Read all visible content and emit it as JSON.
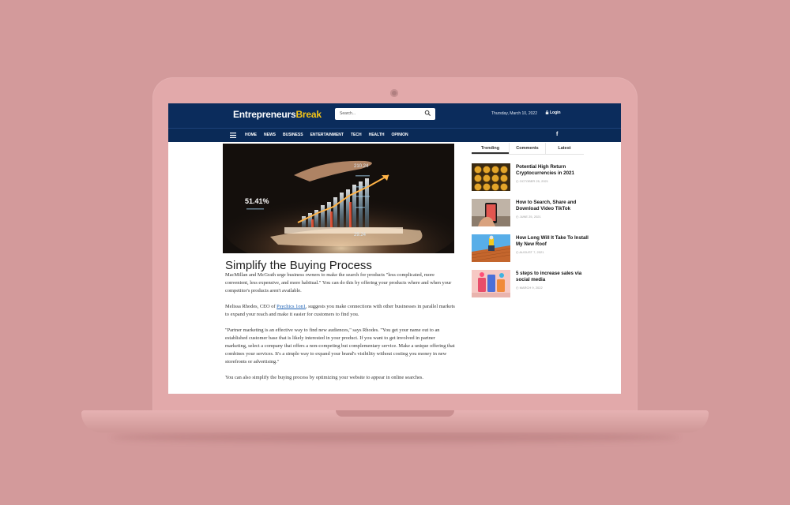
{
  "site": {
    "logo_main": "Entrepreneurs",
    "logo_accent": "Break",
    "search_placeholder": "Search...",
    "date": "Thursday, March 10, 2022",
    "login_label": "Login",
    "colors": {
      "header": "#0b2c5c",
      "accent": "#f5c518",
      "link": "#1a5fb4"
    }
  },
  "nav": {
    "items": [
      "HOME",
      "NEWS",
      "BUSINESS",
      "ENTERTAINMENT",
      "TECH",
      "HEALTH",
      "OPINION"
    ],
    "social": "f"
  },
  "hero": {
    "labels": [
      "210.24",
      "51.41%",
      "29.24"
    ]
  },
  "article": {
    "title": "Simplify the Buying Process",
    "p1": "MacMillan and McGrath urge business owners to make the search for products \"less complicated, more convenient, less expensive, and more habitual.\" You can do this by offering your products where and when your competitor's products aren't available.",
    "p2_before": "Melissa Rhodes, CEO of ",
    "p2_link": "Psychics 1on1",
    "p2_after": ", suggests you make connections with other businesses in parallel markets to expand your reach and make it easier for customers to find you.",
    "p3": "\"Partner marketing is an effective way to find new audiences,\" says Rhodes. \"You get your name out to an established customer base that is likely interested in your product. If you want to get involved in partner marketing, select a company that offers a non-competing but complementary service. Make a unique offering that combines your services. It's a simple way to expand your brand's visibility without costing you money in new storefronts or advertising.\"",
    "p4": "You can also simplify the buying process by optimizing your website to appear in online searches."
  },
  "sidebar": {
    "tabs": [
      "Trending",
      "Comments",
      "Latest"
    ],
    "items": [
      {
        "title": "Potential High Return Cryptocurrencies in 2021",
        "date": "OCTOBER 25, 2021"
      },
      {
        "title": "How to Search, Share and Download Video TikTok",
        "date": "JUNE 25, 2021"
      },
      {
        "title": "How Long Will It Take To Install My New Roof",
        "date": "AUGUST 7, 2021"
      },
      {
        "title": "5 steps to increase sales via social media",
        "date": "MARCH 9, 2022"
      }
    ]
  }
}
